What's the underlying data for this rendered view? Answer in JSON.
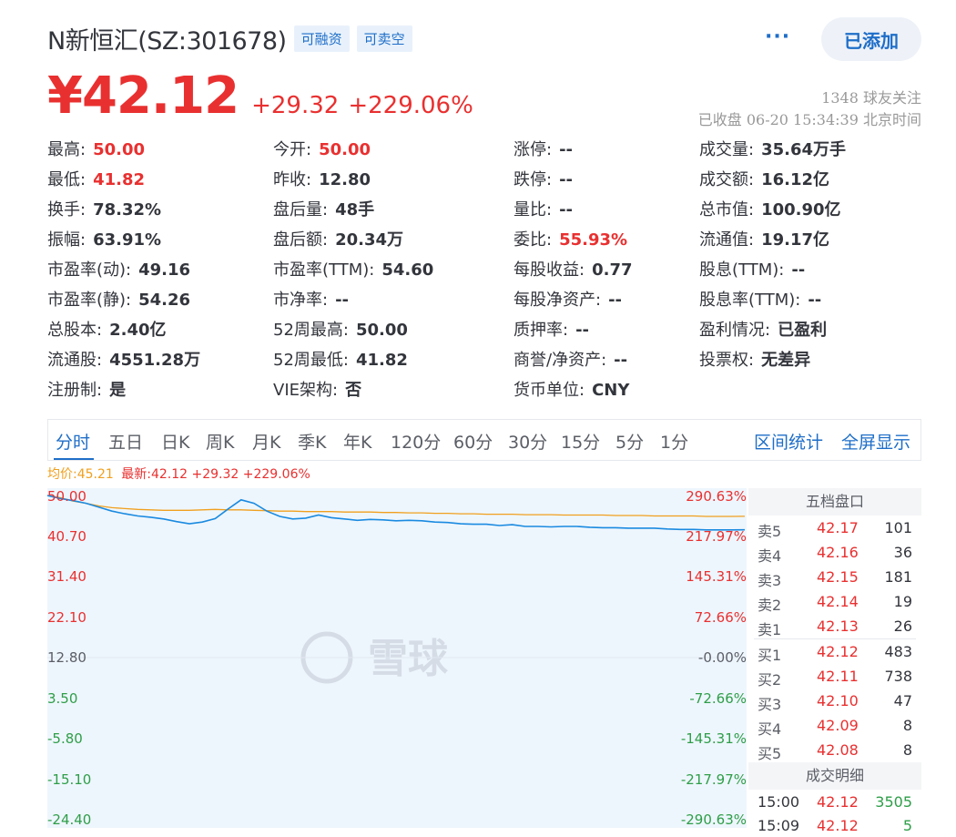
{
  "header": {
    "stock_name": "N新恒汇(SZ:301678)",
    "tags": [
      "可融资",
      "可卖空"
    ],
    "more_label": "···",
    "add_label": "已添加"
  },
  "price": {
    "current": "¥42.12",
    "change": "+29.32",
    "change_pct": "+229.06%",
    "followers": "1348 球友关注",
    "status": "已收盘 06-20 15:34:39 北京时间"
  },
  "quote": {
    "col1": [
      {
        "label": "最高:",
        "value": "50.00",
        "red": true
      },
      {
        "label": "最低:",
        "value": "41.82",
        "red": true
      },
      {
        "label": "换手:",
        "value": "78.32%"
      },
      {
        "label": "振幅:",
        "value": "63.91%"
      },
      {
        "label": "市盈率(动):",
        "value": "49.16"
      },
      {
        "label": "市盈率(静):",
        "value": "54.26"
      },
      {
        "label": "总股本:",
        "value": "2.40亿"
      },
      {
        "label": "流通股:",
        "value": "4551.28万"
      },
      {
        "label": "注册制:",
        "value": "是"
      }
    ],
    "col2": [
      {
        "label": "今开:",
        "value": "50.00",
        "red": true
      },
      {
        "label": "昨收:",
        "value": "12.80"
      },
      {
        "label": "盘后量:",
        "value": "48手"
      },
      {
        "label": "盘后额:",
        "value": "20.34万"
      },
      {
        "label": "市盈率(TTM):",
        "value": "54.60"
      },
      {
        "label": "市净率:",
        "value": "--"
      },
      {
        "label": "52周最高:",
        "value": "50.00"
      },
      {
        "label": "52周最低:",
        "value": "41.82"
      },
      {
        "label": "VIE架构:",
        "value": "否"
      }
    ],
    "col3": [
      {
        "label": "涨停:",
        "value": "--"
      },
      {
        "label": "跌停:",
        "value": "--"
      },
      {
        "label": "量比:",
        "value": "--"
      },
      {
        "label": "委比:",
        "value": "55.93%",
        "red": true
      },
      {
        "label": "每股收益:",
        "value": "0.77"
      },
      {
        "label": "每股净资产:",
        "value": "--"
      },
      {
        "label": "质押率:",
        "value": "--"
      },
      {
        "label": "商誉/净资产:",
        "value": "--"
      },
      {
        "label": "货币单位:",
        "value": "CNY"
      }
    ],
    "col4": [
      {
        "label": "成交量:",
        "value": "35.64万手"
      },
      {
        "label": "成交额:",
        "value": "16.12亿"
      },
      {
        "label": "总市值:",
        "value": "100.90亿"
      },
      {
        "label": "流通值:",
        "value": "19.17亿"
      },
      {
        "label": "股息(TTM):",
        "value": "--"
      },
      {
        "label": "股息率(TTM):",
        "value": "--"
      },
      {
        "label": "盈利情况:",
        "value": "已盈利"
      },
      {
        "label": "投票权:",
        "value": "无差异"
      }
    ]
  },
  "chart_tabs": [
    "分时",
    "五日",
    "日K",
    "周K",
    "月K",
    "季K",
    "年K",
    "120分",
    "60分",
    "30分",
    "15分",
    "5分",
    "1分"
  ],
  "chart_actions": [
    "区间统计",
    "全屏显示"
  ],
  "legend": {
    "avg": "均价:45.21",
    "latest": "最新:42.12 +29.32 +229.06%"
  },
  "watermark": "雪球",
  "colors": {
    "up": "#e93030",
    "down": "#2e9e48",
    "accent": "#1e6ec8",
    "avg_line": "#f0a01e",
    "price_line": "#1a8ae0"
  },
  "chart_data": {
    "type": "line",
    "ylim": [
      -24.4,
      50.0
    ],
    "y_ticks_left": [
      "50.00",
      "40.70",
      "31.40",
      "22.10",
      "12.80",
      "3.50",
      "-5.80",
      "-15.10",
      "-24.40"
    ],
    "y_ticks_right": [
      "290.63%",
      "217.97%",
      "145.31%",
      "72.66%",
      "-0.00%",
      "-72.66%",
      "-145.31%",
      "-217.97%",
      "-290.63%"
    ],
    "series": [
      {
        "name": "最新",
        "values": [
          50.0,
          49.3,
          48.8,
          48.2,
          47.3,
          46.4,
          45.8,
          45.3,
          45.0,
          44.6,
          44.0,
          43.5,
          43.9,
          44.7,
          46.9,
          49.0,
          48.2,
          46.4,
          45.2,
          44.6,
          44.8,
          45.5,
          44.9,
          44.6,
          44.3,
          44.5,
          44.4,
          44.2,
          44.3,
          44.2,
          43.9,
          43.8,
          43.5,
          43.4,
          43.4,
          43.1,
          43.3,
          42.9,
          42.9,
          42.8,
          42.9,
          42.9,
          42.7,
          42.6,
          42.6,
          42.5,
          42.5,
          42.5,
          42.3,
          42.2,
          42.2,
          42.1,
          42.1,
          42.1,
          42.12
        ]
      },
      {
        "name": "均价",
        "values": [
          50.0,
          49.5,
          48.7,
          48.2,
          47.6,
          47.2,
          47.0,
          46.8,
          46.7,
          46.6,
          46.6,
          46.6,
          46.7,
          46.8,
          46.7,
          46.7,
          46.6,
          46.5,
          46.4,
          46.4,
          46.3,
          46.3,
          46.3,
          46.2,
          46.2,
          46.2,
          46.1,
          46.1,
          46.0,
          46.0,
          45.9,
          45.9,
          45.8,
          45.8,
          45.7,
          45.7,
          45.7,
          45.6,
          45.6,
          45.6,
          45.5,
          45.5,
          45.5,
          45.5,
          45.4,
          45.4,
          45.4,
          45.3,
          45.3,
          45.3,
          45.3,
          45.2,
          45.2,
          45.2,
          45.21
        ]
      }
    ]
  },
  "order_book": {
    "title": "五档盘口",
    "asks": [
      {
        "label": "卖5",
        "price": "42.17",
        "vol": "101"
      },
      {
        "label": "卖4",
        "price": "42.16",
        "vol": "36"
      },
      {
        "label": "卖3",
        "price": "42.15",
        "vol": "181"
      },
      {
        "label": "卖2",
        "price": "42.14",
        "vol": "19"
      },
      {
        "label": "卖1",
        "price": "42.13",
        "vol": "26"
      }
    ],
    "bids": [
      {
        "label": "买1",
        "price": "42.12",
        "vol": "483"
      },
      {
        "label": "买2",
        "price": "42.11",
        "vol": "738"
      },
      {
        "label": "买3",
        "price": "42.10",
        "vol": "47"
      },
      {
        "label": "买4",
        "price": "42.09",
        "vol": "8"
      },
      {
        "label": "买5",
        "price": "42.08",
        "vol": "8"
      }
    ]
  },
  "trades": {
    "title": "成交明细",
    "rows": [
      {
        "time": "15:00",
        "price": "42.12",
        "vol": "3505"
      },
      {
        "time": "15:09",
        "price": "42.12",
        "vol": "5"
      }
    ]
  }
}
